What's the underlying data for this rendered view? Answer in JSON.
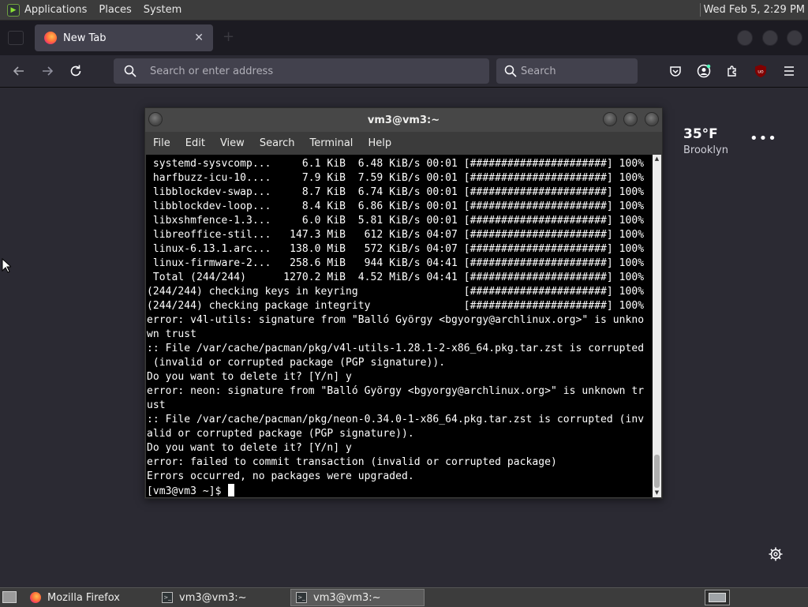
{
  "top_panel": {
    "menus": [
      "Applications",
      "Places",
      "System"
    ],
    "clock": "Wed Feb  5,  2:29 PM"
  },
  "browser": {
    "tab_title": "New Tab",
    "address_placeholder": "Search or enter address",
    "search_placeholder": "Search",
    "ublock_badge": "uo"
  },
  "weather": {
    "temperature": "35°F",
    "location": "Brooklyn"
  },
  "terminal": {
    "title": "vm3@vm3:~",
    "menu": [
      "File",
      "Edit",
      "View",
      "Search",
      "Terminal",
      "Help"
    ],
    "lines": [
      " systemd-sysvcomp...     6.1 KiB  6.48 KiB/s 00:01 [######################] 100%",
      " harfbuzz-icu-10....     7.9 KiB  7.59 KiB/s 00:01 [######################] 100%",
      " libblockdev-swap...     8.7 KiB  6.74 KiB/s 00:01 [######################] 100%",
      " libblockdev-loop...     8.4 KiB  6.86 KiB/s 00:01 [######################] 100%",
      " libxshmfence-1.3...     6.0 KiB  5.81 KiB/s 00:01 [######################] 100%",
      " libreoffice-stil...   147.3 MiB   612 KiB/s 04:07 [######################] 100%",
      " linux-6.13.1.arc...   138.0 MiB   572 KiB/s 04:07 [######################] 100%",
      " linux-firmware-2...   258.6 MiB   944 KiB/s 04:41 [######################] 100%",
      " Total (244/244)      1270.2 MiB  4.52 MiB/s 04:41 [######################] 100%",
      "(244/244) checking keys in keyring                 [######################] 100%",
      "(244/244) checking package integrity               [######################] 100%",
      "error: v4l-utils: signature from \"Balló György <bgyorgy@archlinux.org>\" is unkno",
      "wn trust",
      ":: File /var/cache/pacman/pkg/v4l-utils-1.28.1-2-x86_64.pkg.tar.zst is corrupted",
      " (invalid or corrupted package (PGP signature)).",
      "Do you want to delete it? [Y/n] y",
      "error: neon: signature from \"Balló György <bgyorgy@archlinux.org>\" is unknown tr",
      "ust",
      ":: File /var/cache/pacman/pkg/neon-0.34.0-1-x86_64.pkg.tar.zst is corrupted (inv",
      "alid or corrupted package (PGP signature)).",
      "Do you want to delete it? [Y/n] y",
      "error: failed to commit transaction (invalid or corrupted package)",
      "Errors occurred, no packages were upgraded."
    ],
    "prompt": "[vm3@vm3 ~]$ "
  },
  "taskbar": {
    "tasks": [
      "Mozilla Firefox",
      "vm3@vm3:~",
      "vm3@vm3:~"
    ]
  },
  "icons": {
    "distro": "arch-logo-icon",
    "back": "back-arrow-icon",
    "forward": "forward-arrow-icon",
    "reload": "reload-icon",
    "pocket": "pocket-icon",
    "account": "account-icon",
    "extensions": "extensions-icon",
    "ublock": "ublock-origin-icon",
    "menu": "hamburger-menu-icon",
    "settings": "gear-icon"
  },
  "colors": {
    "page_bg": "#2b2a33",
    "terminal_bg": "#000000",
    "terminal_text": "#ffffff",
    "panel_bg": "#3c3c3c"
  }
}
